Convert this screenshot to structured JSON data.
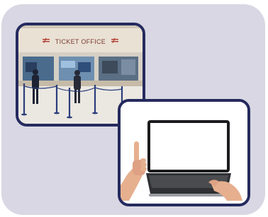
{
  "photos": {
    "ticket_office": {
      "sign_text": "TICKET OFFICE"
    },
    "laptop": {}
  },
  "colors": {
    "card_background": "#d8d7e3",
    "frame_border": "#252a5e",
    "sign_text": "#7a3b32"
  },
  "icons": [
    "rail-logo-icon",
    "thumbs-up-hand",
    "laptop"
  ]
}
